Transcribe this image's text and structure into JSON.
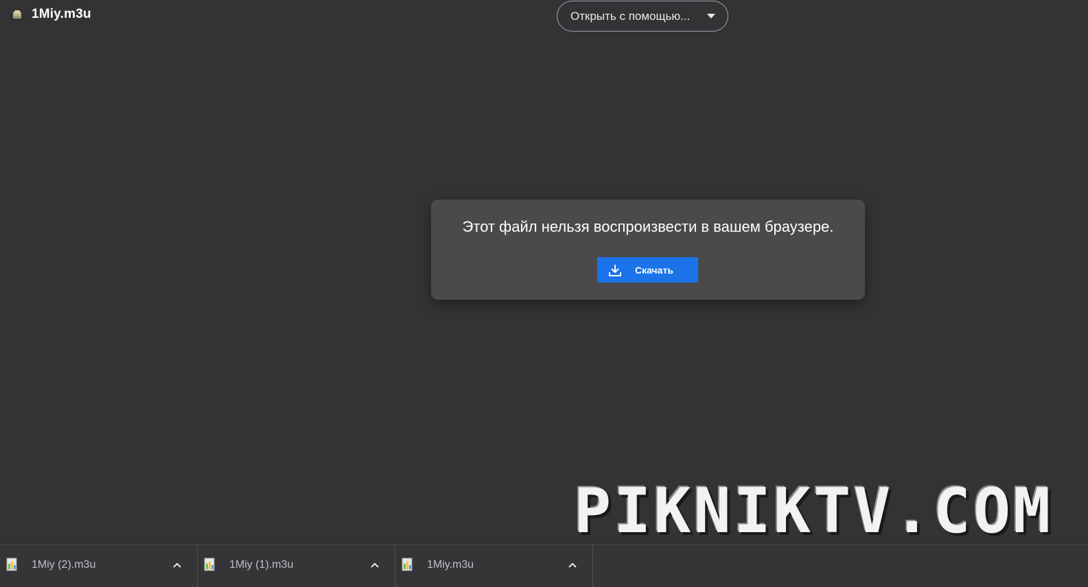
{
  "header": {
    "file_name": "1Miy.m3u",
    "open_with_label": "Открыть с помощью..."
  },
  "dialog": {
    "message": "Этот файл нельзя воспроизвести в вашем браузере.",
    "download_label": "Скачать"
  },
  "watermark": {
    "text": "PIKNIKTV.COM"
  },
  "downloads": [
    {
      "name": "1Miy (2).m3u"
    },
    {
      "name": "1Miy (1).m3u"
    },
    {
      "name": "1Miy.m3u"
    }
  ],
  "colors": {
    "background": "#333234",
    "accent": "#1a73e8",
    "dialog": "#4a494b"
  }
}
